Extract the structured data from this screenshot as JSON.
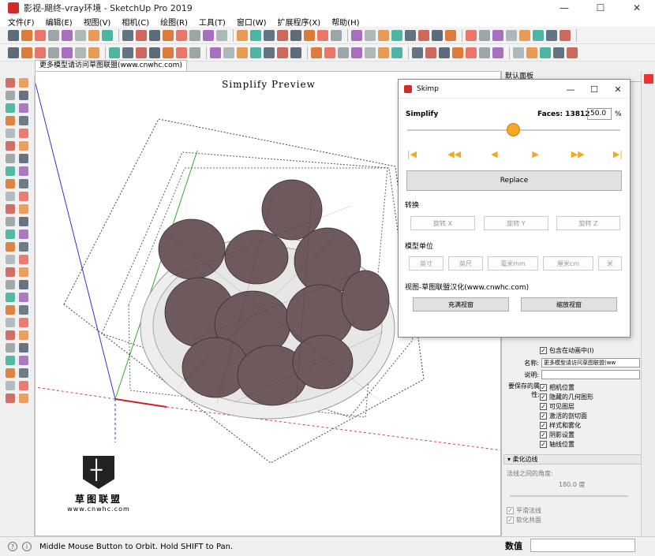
{
  "window": {
    "title": "影视-飓终-vray环境 - SketchUp Pro 2019"
  },
  "menu": [
    "文件(F)",
    "编辑(E)",
    "视图(V)",
    "相机(C)",
    "绘图(R)",
    "工具(T)",
    "窗口(W)",
    "扩展程序(X)",
    "帮助(H)"
  ],
  "scene_tab": {
    "label": "更多模型请访问草图联盟(www.cnwhc.com)"
  },
  "viewport": {
    "preview_title": "Simplify Preview",
    "logo_cn": "草图联盟",
    "logo_url": "www.cnwhc.com"
  },
  "status_bar": {
    "message": "Middle Mouse Button to Orbit. Hold SHIFT to Pan.",
    "measure_label": "数值"
  },
  "right_panel": {
    "header": "默认面板",
    "include_animation": "包含在动画中(I)",
    "name_label": "名称:",
    "name_value": "更多模型请访问草图联盟(ww",
    "desc_label": "说明:",
    "saved_props_label": "要保存的属性:",
    "properties": [
      "相机位置",
      "隐藏的几何图形",
      "可见图层",
      "激活的剖切面",
      "样式和雾化",
      "阴影设置",
      "轴线位置"
    ],
    "soften_header": "柔化边线",
    "angle_label": "法线之间的角度:",
    "angle_value": "180.0 度",
    "smooth_normals": "平滑法线",
    "soften_coplanar": "软化共面"
  },
  "dialog": {
    "title": "Skimp",
    "simplify_label": "Simplify",
    "faces_label": "Faces: 13812",
    "percent_value": "50.0",
    "percent_sign": "%",
    "slider_fraction": 0.5,
    "replace_label": "Replace",
    "transform_label": "转换",
    "rotate_buttons": [
      "旋转 X",
      "旋转 Y",
      "旋转 Z"
    ],
    "units_label": "模型单位",
    "unit_buttons": [
      "英寸",
      "英尺",
      "毫米mm",
      "厘米cm",
      "米"
    ],
    "view_label": "视图-草图联盟汉化(www.cnwhc.com)",
    "fill_view": "充满视窗",
    "zoom_view": "缩放视窗"
  },
  "colors": {
    "accent_orange": "#f5a623",
    "brand_red": "#d52a2a",
    "fig_fill": "#6e5a5c"
  }
}
